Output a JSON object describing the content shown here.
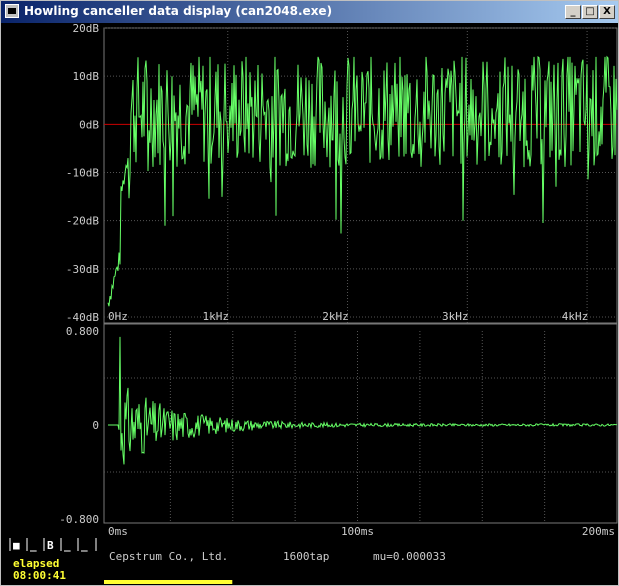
{
  "window": {
    "title": "Howling canceller data display (can2048.exe)",
    "min_glyph": "_",
    "max_glyph": "□",
    "close_glyph": "X"
  },
  "spectrum": {
    "y_ticks": [
      "20dB",
      "10dB",
      "0dB",
      "-10dB",
      "-20dB",
      "-30dB",
      "-40dB"
    ],
    "y_values": [
      20,
      10,
      0,
      -10,
      -20,
      -30,
      -40
    ],
    "x_ticks": [
      "0Hz",
      "1kHz",
      "2kHz",
      "3kHz",
      "4kHz"
    ],
    "x_values": [
      0,
      1000,
      2000,
      3000,
      4000
    ],
    "trace_color": "#66ff66",
    "zero_line_color": "#cc0000",
    "grid_color": "#555555"
  },
  "cepstrum": {
    "y_ticks": [
      "0.800",
      "0",
      "-0.800"
    ],
    "y_values": [
      0.8,
      0,
      -0.8
    ],
    "x_ticks": [
      "0ms",
      "100ms",
      "200ms"
    ],
    "x_values": [
      0,
      100,
      200
    ],
    "trace_color": "#66ff66"
  },
  "status": {
    "mode_buttons": [
      "■",
      "_",
      "B",
      "_",
      "_"
    ],
    "elapsed_label": "elapsed",
    "elapsed_time": "08:00:41",
    "company": "Cepstrum Co., Ltd.",
    "taps": "1600tap",
    "mu": "mu=0.000033",
    "progress": 0.25,
    "accent": "#ffff33"
  }
}
